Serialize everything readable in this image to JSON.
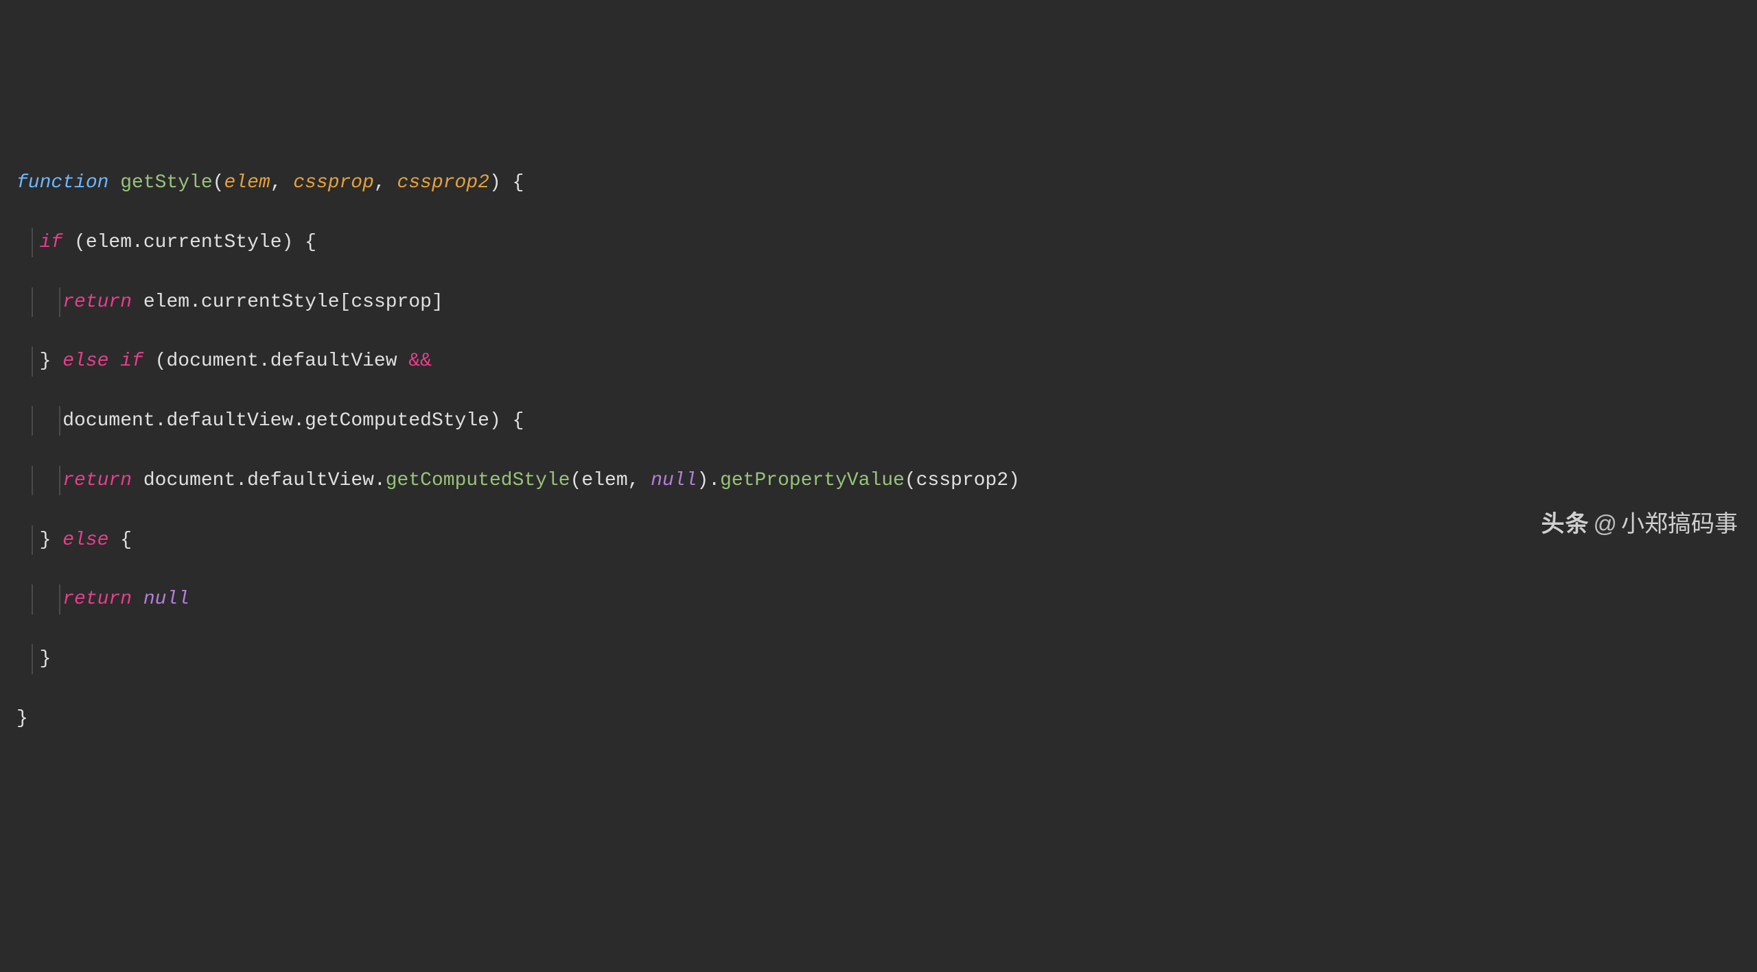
{
  "code": {
    "line1": {
      "function": "function",
      "name": "getStyle",
      "p1": "elem",
      "p2": "cssprop",
      "p3": "cssprop2",
      "lparen": "(",
      "comma": ", ",
      "rparen": ")",
      "space": " ",
      "lbrace": "{"
    },
    "line2": {
      "if": "if",
      "lparen": " (",
      "elem": "elem",
      "dot": ".",
      "currentStyle": "currentStyle",
      "rparen": ") ",
      "lbrace": "{"
    },
    "line3": {
      "return": "return",
      "space": " ",
      "elem": "elem",
      "dot": ".",
      "currentStyle": "currentStyle",
      "lbracket": "[",
      "cssprop": "cssprop",
      "rbracket": "]"
    },
    "line4": {
      "rbrace": "}",
      "else": " else ",
      "if": "if",
      "lparen": " (",
      "document": "document",
      "dot": ".",
      "defaultView": "defaultView",
      "and": " &&"
    },
    "line5": {
      "document": "document",
      "dot1": ".",
      "defaultView": "defaultView",
      "dot2": ".",
      "getComputedStyle": "getComputedStyle",
      "rparen": ") ",
      "lbrace": "{"
    },
    "line6": {
      "return": "return",
      "space": " ",
      "document": "document",
      "dot1": ".",
      "defaultView": "defaultView",
      "dot2": ".",
      "getComputedStyle": "getComputedStyle",
      "lparen1": "(",
      "elem": "elem",
      "comma": ", ",
      "null": "null",
      "rparen1": ")",
      "dot3": ".",
      "getPropertyValue": "getPropertyValue",
      "lparen2": "(",
      "cssprop2": "cssprop2",
      "rparen2": ")"
    },
    "line7": {
      "rbrace": "}",
      "else": " else ",
      "lbrace": "{"
    },
    "line8": {
      "return": "return",
      "space": " ",
      "null": "null"
    },
    "line9": {
      "rbrace": "}"
    },
    "line10": {
      "rbrace": "}"
    }
  },
  "watermark": {
    "brand": "头条",
    "at": "@",
    "author": "小郑搞码事"
  }
}
